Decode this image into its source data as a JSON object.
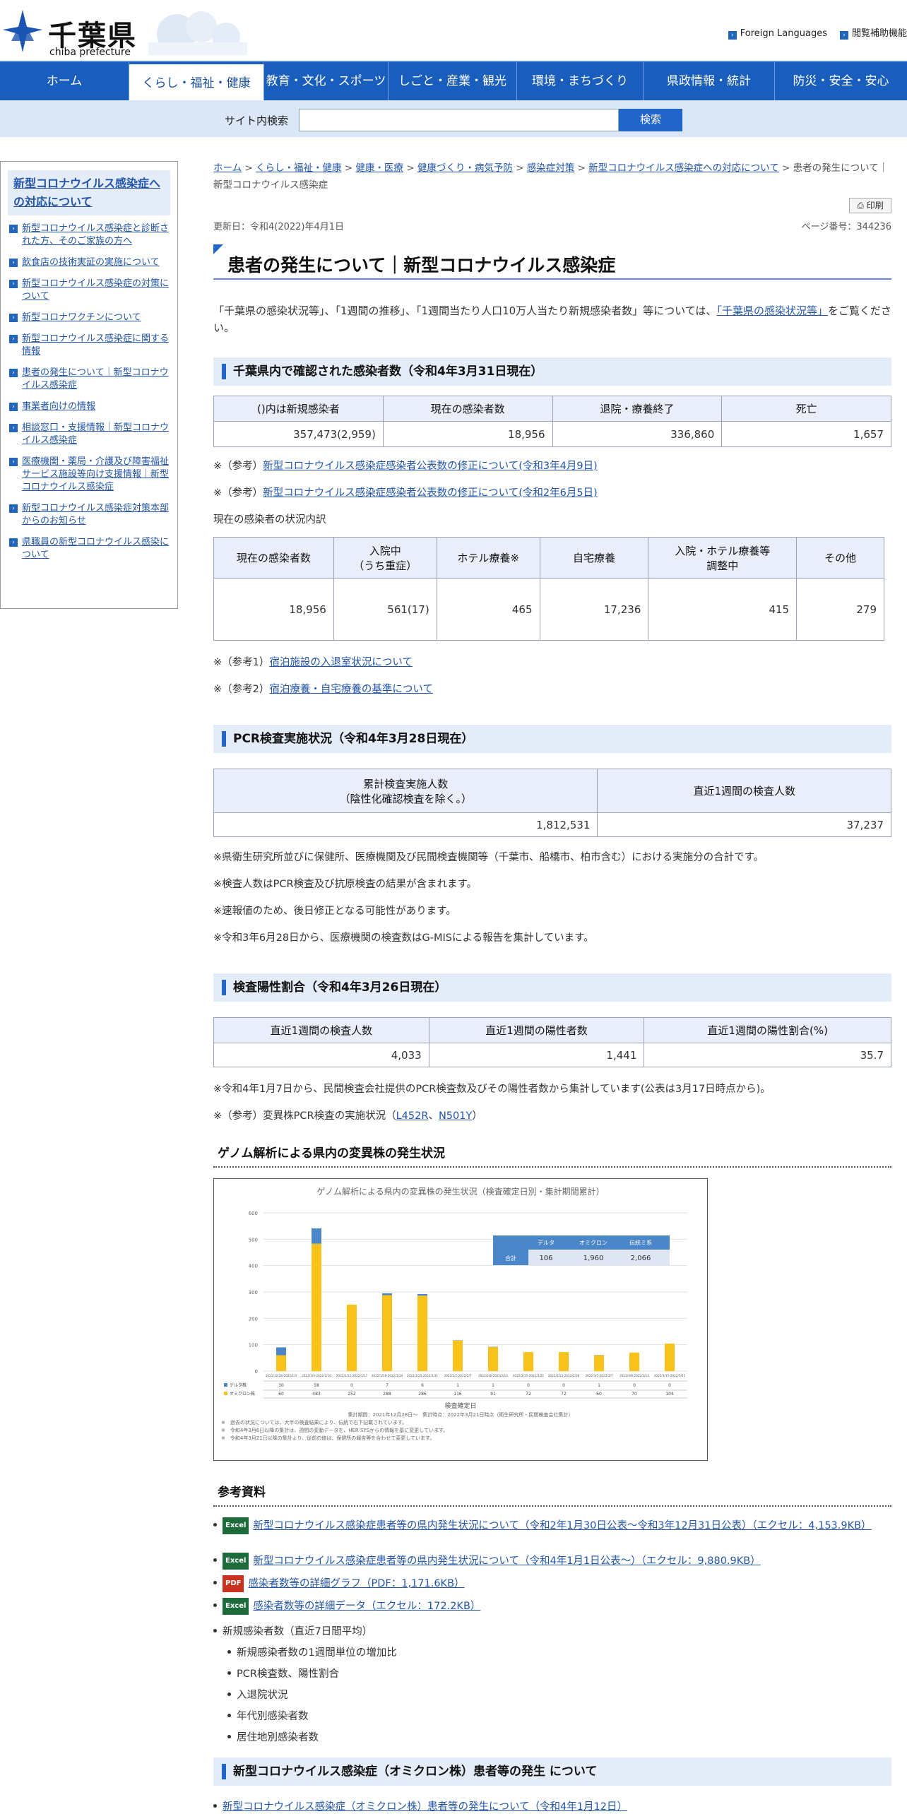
{
  "header": {
    "logo_ja": "千葉県",
    "logo_en": "chiba prefecture",
    "links": [
      "Foreign Languages",
      "閲覧補助機能"
    ]
  },
  "gnav": [
    "ホーム",
    "くらし・福祉・健康",
    "教育・文化・スポーツ",
    "しごと・産業・観光",
    "環境・まちづくり",
    "県政情報・統計",
    "防災・安全・安心"
  ],
  "search": {
    "label": "サイト内検索",
    "button": "検索",
    "value": "",
    "placeholder": ""
  },
  "sidebar": {
    "title": "新型コロナウイルス感染症への対応について",
    "items": [
      "新型コロナウイルス感染症と診断された方、そのご家族の方へ",
      "飲食店の技術実証の実施について",
      "新型コロナウイルス感染症の対策について",
      "新型コロナワクチンについて",
      "新型コロナウイルス感染症に関する情報",
      "患者の発生について｜新型コロナウイルス感染症",
      "事業者向けの情報",
      "相談窓口・支援情報｜新型コロナウイルス感染症",
      "医療機関・薬局・介護及び障害福祉サービス施設等向け支援情報｜新型コロナウイルス感染症",
      "新型コロナウイルス感染症対策本部からのお知らせ",
      "県職員の新型コロナウイルス感染について"
    ]
  },
  "breadcrumb": {
    "links": [
      "ホーム",
      "くらし・福祉・健康",
      "健康・医療",
      "健康づくり・病気予防",
      "感染症対策",
      "新型コロナウイルス感染症への対応について"
    ],
    "sep": " > ",
    "current": "患者の発生について｜新型コロナウイルス感染症"
  },
  "print_label": "印刷",
  "update": "更新日：令和4(2022)年4月1日",
  "page_no": "ページ番号：344236",
  "title": "患者の発生について｜新型コロナウイルス感染症",
  "intro": {
    "text": "「千葉県の感染状況等」、「1週間の推移」、「1週間当たり人口10万人当たり新規感染者数」等については、",
    "link": "「千葉県の感染状況等」",
    "after": "をご覧ください。"
  },
  "sec1": {
    "heading": "千葉県内で確認された感染者数（令和4年3月31日現在）",
    "headers": [
      "()内は新規感染者",
      "現在の感染者数",
      "退院・療養終了",
      "死亡"
    ],
    "values": [
      "357,473(2,959)",
      "18,956",
      "336,860",
      "1,657"
    ],
    "refs": [
      {
        "prefix": "※（参考）",
        "link": "新型コロナウイルス感染症感染者公表数の修正について(令和3年4月9日)"
      },
      {
        "prefix": "※（参考）",
        "link": "新型コロナウイルス感染症感染者公表数の修正について(令和2年6月5日)"
      }
    ],
    "breakdown_label": "現在の感染者の状況内訳",
    "bd_headers": [
      "現在の感染者数",
      "入院中\n（うち重症）",
      "ホテル療養※",
      "自宅療養",
      "入院・ホテル療養等\n調整中",
      "その他"
    ],
    "bd_values": [
      "18,956",
      "561(17)",
      "465",
      "17,236",
      "415",
      "279"
    ],
    "refs2": [
      {
        "prefix": "※（参考1）",
        "link": "宿泊施設の入退室状況について"
      },
      {
        "prefix": "※（参考2）",
        "link": "宿泊療養・自宅療養の基準について"
      }
    ]
  },
  "sec2": {
    "heading": "PCR検査実施状況（令和4年3月28日現在）",
    "headers": [
      "累計検査実施人数\n（陰性化確認検査を除く。）",
      "直近1週間の検査人数"
    ],
    "values": [
      "1,812,531",
      "37,237"
    ],
    "notes": [
      "※県衛生研究所並びに保健所、医療機関及び民間検査機関等（千葉市、船橋市、柏市含む）における実施分の合計です。",
      "※検査人数はPCR検査及び抗原検査の結果が含まれます。",
      "※速報値のため、後日修正となる可能性があります。",
      "※令和3年6月28日から、医療機関の検査数はG-MISによる報告を集計しています。"
    ]
  },
  "sec3": {
    "heading": "検査陽性割合（令和4年3月26日現在）",
    "headers": [
      "直近1週間の検査人数",
      "直近1週間の陽性者数",
      "直近1週間の陽性割合(%)"
    ],
    "values": [
      "4,033",
      "1,441",
      "35.7"
    ],
    "note": "※令和4年1月7日から、民間検査会社提供のPCR検査数及びその陽性者数から集計しています(公表は3月17日時点から)。",
    "ref": {
      "prefix": "※（参考）変異株PCR検査の実施状況（",
      "l1": "L452R",
      "sep": "、",
      "l2": "N501Y",
      "suffix": "）"
    }
  },
  "genome": {
    "heading": "ゲノム解析による県内の変異株の発生状況"
  },
  "chart_data": {
    "type": "bar",
    "title": "ゲノム解析による県内の変異株の発生状況（検査確定日別・集計期間累計）",
    "xlabel": "検査確定日",
    "ylim": [
      0,
      600
    ],
    "yticks": [
      0,
      100,
      200,
      300,
      400,
      500,
      600
    ],
    "categories": [
      "2021/12/28-2022/1/3",
      "2022/1/4-2022/1/10",
      "2022/1/11-2022/1/17",
      "2022/1/18-2022/1/24",
      "2022/1/25-2022/1/31",
      "2022/2/1-2022/2/7",
      "2022/2/8-2022/2/14",
      "2022/2/15-2022/2/21",
      "2022/2/22-2022/2/28",
      "2022/3/1-2022/3/7",
      "2022/3/8-2022/3/14",
      "2022/3/15-2022/3/21"
    ],
    "series": [
      {
        "name": "デルタ株",
        "values": [
          30,
          58,
          0,
          7,
          6,
          1,
          1,
          0,
          0,
          1,
          0,
          0
        ],
        "color": "#4a86c8"
      },
      {
        "name": "オミクロン株",
        "values": [
          60,
          483,
          252,
          288,
          286,
          116,
          91,
          72,
          72,
          60,
          70,
          104
        ],
        "color": "#f7c21a"
      }
    ],
    "summary": {
      "headers": [
        "デルタ",
        "オミクロン",
        "伝統ミ系"
      ],
      "row_label": "合計",
      "values": [
        "106",
        "1,960",
        "2,066"
      ]
    },
    "footnotes": [
      "集計期間：2021年12月28日～　集計時点：2022年3月21日時点（衛生研究所・民間検査会社集計）",
      "※　過去の状況については、大半の検査結果により、伝統で右下記載されています。",
      "※　令和4年3月6日以降の集計は、週間の変動データを、HER-SYSからの情報を基に変更しています。",
      "※　令和4年3月21日以降の集計より、従前の値は、保健所の報告等を合わせて変更しています。"
    ]
  },
  "refs_section": {
    "heading": "参考資料",
    "items": [
      {
        "badge": "Excel",
        "text": "新型コロナウイルス感染症患者等の県内発生状況について（令和2年1月30日公表〜令和3年12月31日公表）（エクセル：4,153.9KB）"
      },
      {
        "badge": "Excel",
        "text": "新型コロナウイルス感染症患者等の県内発生状況について（令和4年1月1日公表〜）（エクセル：9,880.9KB）"
      },
      {
        "badge": "PDF",
        "text": "感染者数等の詳細グラフ（PDF：1,171.6KB）"
      },
      {
        "badge": "Excel",
        "text": "感染者数等の詳細データ（エクセル：172.2KB）"
      }
    ],
    "sub_label": "新規感染者数（直近7日間平均）",
    "sub_items": [
      "新規感染者数の1週間単位の増加比",
      "PCR検査数、陽性割合",
      "入退院状況",
      "年代別感染者数",
      "居住地別感染者数"
    ]
  },
  "sec_omicron": {
    "heading": "新型コロナウイルス感染症（オミクロン株）患者等の発生 について",
    "link": "新型コロナウイルス感染症（オミクロン株）患者等の発生について（令和4年1月12日）"
  }
}
